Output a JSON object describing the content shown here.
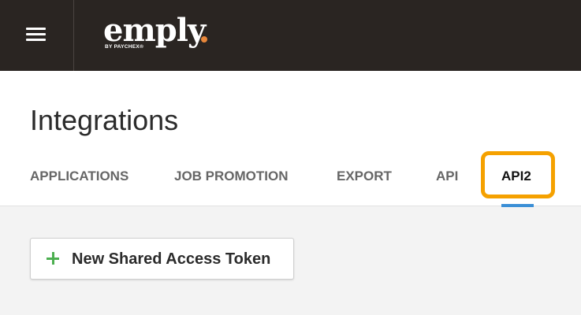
{
  "brand": {
    "name": "emply",
    "tagline": "BY PAYCHEX®",
    "accent_color": "#e8873a"
  },
  "topbar": {
    "menu_icon": "hamburger-menu-icon",
    "background_color": "#2a2522"
  },
  "page": {
    "title": "Integrations"
  },
  "tabs": [
    {
      "label": "APPLICATIONS",
      "active": false
    },
    {
      "label": "JOB PROMOTION",
      "active": false
    },
    {
      "label": "EXPORT",
      "active": false
    },
    {
      "label": "API",
      "active": false
    },
    {
      "label": "API2",
      "active": true
    }
  ],
  "highlight_color": "#f5a100",
  "active_tab_indicator_color": "#3b8fd6",
  "actions": {
    "new_token_label": "New Shared Access Token",
    "new_token_icon": "plus-icon",
    "plus_color": "#4caf50"
  }
}
